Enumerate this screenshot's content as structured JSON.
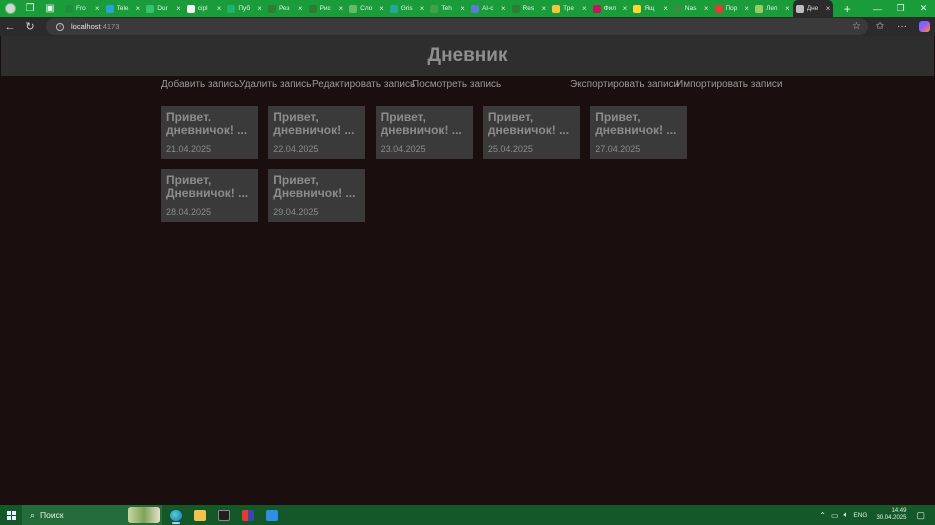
{
  "browser": {
    "tabs": [
      {
        "label": "Fro",
        "color": "#1e8e3e"
      },
      {
        "label": "Tele",
        "color": "#2aa1d8"
      },
      {
        "label": "Dur",
        "color": "#34c36a"
      },
      {
        "label": "cipl",
        "color": "#f2f2f2"
      },
      {
        "label": "Пуб",
        "color": "#1fb16e"
      },
      {
        "label": "Рез",
        "color": "#2e7d32"
      },
      {
        "label": "Рис",
        "color": "#2e7d32"
      },
      {
        "label": "Сло",
        "color": "#66bb6a"
      },
      {
        "label": "Gris",
        "color": "#26a69a"
      },
      {
        "label": "Teh",
        "color": "#43a047"
      },
      {
        "label": "АІ-с",
        "color": "#5b7bd5"
      },
      {
        "label": "Res",
        "color": "#2e7d32"
      },
      {
        "label": "Тре",
        "color": "#f5c542"
      },
      {
        "label": "Фил",
        "color": "#c2185b"
      },
      {
        "label": "Ящ",
        "color": "#fdd835"
      },
      {
        "label": "Nas",
        "color": "#388e3c"
      },
      {
        "label": "Пор",
        "color": "#e53935"
      },
      {
        "label": "Леп",
        "color": "#9ccc65"
      },
      {
        "label": "Дне",
        "color": "#bdbdbd",
        "active": true
      }
    ],
    "address": {
      "host": "localhost",
      "port": ":4173"
    }
  },
  "app": {
    "title": "Дневник",
    "menu": {
      "add": "Добавить запись",
      "delete": "Удалить запись",
      "edit": "Редактировать запись",
      "view": "Посмотреть запись",
      "export": "Экспортировать записи",
      "import": "Импортировать записи"
    },
    "entries": [
      {
        "title": "Привет. дневничок! ...",
        "date": "21.04.2025"
      },
      {
        "title": "Привет, дневничок! ...",
        "date": "22.04.2025"
      },
      {
        "title": "Привет, дневничок! ...",
        "date": "23.04.2025"
      },
      {
        "title": "Привет, дневничок! ...",
        "date": "25.04.2025"
      },
      {
        "title": "Привет, дневничок! ...",
        "date": "27.04.2025"
      },
      {
        "title": "Привет, Дневничок! ...",
        "date": "28.04.2025"
      },
      {
        "title": "Привет, Дневничок! ...",
        "date": "29.04.2025"
      }
    ]
  },
  "taskbar": {
    "search_label": "Поиск",
    "language": "ENG",
    "time": "14:49",
    "date": "30.04.2025"
  },
  "colors": {
    "tab_strip": "#1a9c3a",
    "page_bg": "#1b0e0e",
    "card_bg": "#3a3a3a",
    "header_bg": "#2e2e2e",
    "taskbar": "#14582a"
  }
}
